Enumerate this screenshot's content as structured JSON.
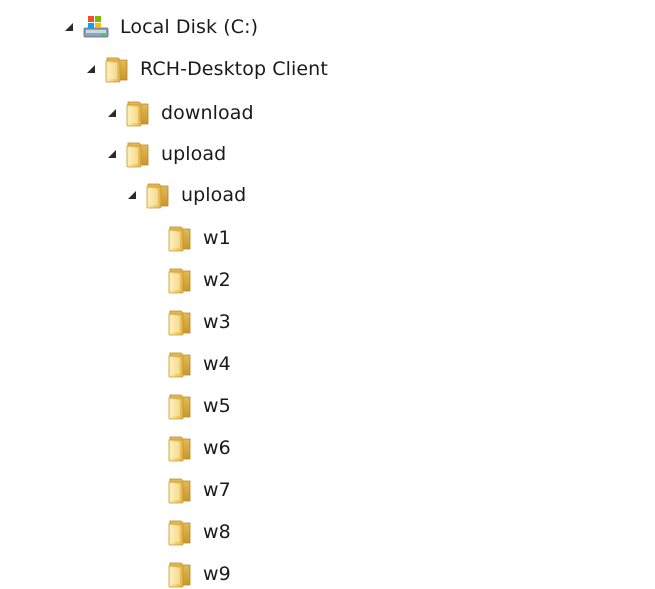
{
  "tree": {
    "root": {
      "label": "Local Disk (C:)",
      "icon": "drive-icon",
      "expanded": true
    },
    "rch": {
      "label": "RCH-Desktop Client",
      "icon": "folder-icon",
      "expanded": true
    },
    "download": {
      "label": "download",
      "icon": "folder-icon",
      "expanded": true
    },
    "upload": {
      "label": "upload",
      "icon": "folder-icon",
      "expanded": true
    },
    "upload_inner": {
      "label": "upload",
      "icon": "folder-icon",
      "expanded": true
    },
    "children": [
      {
        "label": "w1",
        "icon": "folder-icon"
      },
      {
        "label": "w2",
        "icon": "folder-icon"
      },
      {
        "label": "w3",
        "icon": "folder-icon"
      },
      {
        "label": "w4",
        "icon": "folder-icon"
      },
      {
        "label": "w5",
        "icon": "folder-icon"
      },
      {
        "label": "w6",
        "icon": "folder-icon"
      },
      {
        "label": "w7",
        "icon": "folder-icon"
      },
      {
        "label": "w8",
        "icon": "folder-icon"
      },
      {
        "label": "w9",
        "icon": "folder-icon"
      }
    ]
  },
  "colors": {
    "folder_body": "#F2CF6E",
    "folder_dark": "#D9A93A",
    "folder_light": "#FBE9A6",
    "arrow": "#2b2b2b",
    "text": "#1a1a1a"
  }
}
